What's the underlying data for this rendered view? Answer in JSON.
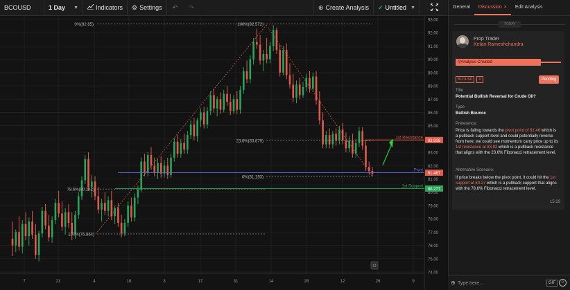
{
  "toolbar": {
    "symbol": "BCOUSD",
    "timeframe": "1 Day",
    "indicators_label": "Indicators",
    "settings_label": "Settings",
    "create_analysis_label": "Create Analysis",
    "untitled_label": "Untitled"
  },
  "chart_data": {
    "type": "candlestick",
    "symbol": "BCOUSD",
    "ylim": [
      74,
      93
    ],
    "y_ticks": [
      "93.00",
      "92.00",
      "91.00",
      "90.00",
      "89.00",
      "88.00",
      "87.00",
      "86.00",
      "85.00",
      "84.00",
      "83.00",
      "82.00",
      "81.00",
      "80.00",
      "79.00",
      "78.00",
      "77.00",
      "76.00",
      "75.00",
      "74.00"
    ],
    "x_ticks": [
      "7",
      "21",
      "4",
      "18",
      "3",
      "17",
      "31",
      "14",
      "28",
      "12",
      "26",
      "9"
    ],
    "price_labels": [
      {
        "value": 83.928,
        "text": "83.928",
        "color": "#e05a4a"
      },
      {
        "value": 81.467,
        "text": "81.467",
        "color": "#e05a4a"
      },
      {
        "value": 80.277,
        "text": "80.277",
        "color": "#2ca55a"
      }
    ],
    "levels": [
      {
        "name": "1st Resistance",
        "value": 83.928,
        "color": "#e05a4a"
      },
      {
        "name": "Pivot",
        "value": 81.467,
        "color": "#5865d8"
      },
      {
        "name": "1st Support",
        "value": 80.277,
        "color": "#2ca55a"
      }
    ],
    "fib_labels": [
      {
        "text": "0%(92.65)",
        "value": 92.65
      },
      {
        "text": "100%(92.572)",
        "value": 92.572
      },
      {
        "text": "23.6%(83.879)",
        "value": 83.879
      },
      {
        "text": "0%(81.193)",
        "value": 81.193
      },
      {
        "text": "78.6%(80.242)",
        "value": 80.242
      },
      {
        "text": "100%(76.864)",
        "value": 76.864
      }
    ],
    "colors": {
      "up": "#26a65b",
      "down": "#e05a4a",
      "bg": "#131313",
      "grid": "#1f1f1f",
      "arrow": "#2bd13a"
    },
    "candles": [
      [
        76.5,
        77.8,
        75.2,
        76.0
      ],
      [
        76.0,
        77.2,
        75.5,
        77.0
      ],
      [
        77.0,
        78.2,
        75.6,
        75.9
      ],
      [
        75.9,
        77.9,
        75.4,
        77.6
      ],
      [
        77.6,
        78.5,
        76.4,
        76.7
      ],
      [
        76.7,
        78.1,
        76.0,
        77.8
      ],
      [
        77.8,
        78.6,
        76.5,
        76.8
      ],
      [
        76.8,
        77.6,
        75.0,
        75.3
      ],
      [
        75.3,
        77.1,
        74.8,
        76.9
      ],
      [
        76.9,
        78.9,
        76.6,
        78.6
      ],
      [
        78.6,
        79.1,
        77.2,
        77.5
      ],
      [
        77.5,
        78.3,
        76.3,
        76.6
      ],
      [
        76.6,
        78.2,
        76.2,
        77.9
      ],
      [
        77.9,
        79.5,
        77.6,
        79.2
      ],
      [
        79.2,
        80.1,
        78.1,
        78.4
      ],
      [
        78.4,
        79.3,
        77.1,
        77.4
      ],
      [
        77.4,
        78.8,
        76.8,
        78.5
      ],
      [
        78.5,
        79.1,
        77.3,
        77.7
      ],
      [
        77.7,
        78.5,
        76.4,
        76.9
      ],
      [
        76.9,
        78.6,
        76.5,
        78.3
      ],
      [
        78.3,
        80.0,
        78.0,
        79.7
      ],
      [
        79.7,
        81.2,
        79.4,
        80.9
      ],
      [
        80.9,
        82.8,
        80.6,
        82.5
      ],
      [
        82.5,
        83.0,
        80.1,
        80.4
      ],
      [
        80.4,
        81.3,
        79.6,
        80.8
      ],
      [
        80.8,
        81.2,
        79.4,
        79.7
      ],
      [
        79.7,
        80.4,
        78.4,
        78.7
      ],
      [
        78.7,
        79.5,
        77.8,
        79.2
      ],
      [
        79.2,
        80.0,
        78.3,
        78.6
      ],
      [
        78.6,
        79.7,
        78.2,
        79.4
      ],
      [
        79.4,
        80.1,
        77.9,
        78.2
      ],
      [
        78.2,
        79.0,
        77.6,
        78.8
      ],
      [
        78.8,
        79.2,
        77.4,
        77.7
      ],
      [
        77.7,
        78.3,
        76.6,
        76.9
      ],
      [
        76.9,
        78.0,
        76.7,
        77.7
      ],
      [
        77.7,
        79.3,
        77.4,
        79.0
      ],
      [
        79.0,
        79.6,
        77.8,
        78.1
      ],
      [
        78.1,
        79.9,
        77.8,
        79.6
      ],
      [
        79.6,
        80.5,
        79.1,
        80.2
      ],
      [
        80.2,
        82.6,
        80.0,
        82.3
      ],
      [
        82.3,
        82.9,
        81.2,
        81.5
      ],
      [
        81.5,
        83.0,
        81.2,
        82.8
      ],
      [
        82.8,
        83.4,
        81.7,
        82.0
      ],
      [
        82.0,
        82.6,
        81.2,
        81.5
      ],
      [
        81.5,
        82.5,
        81.0,
        82.2
      ],
      [
        82.2,
        82.7,
        81.1,
        81.4
      ],
      [
        81.4,
        82.4,
        81.1,
        82.0
      ],
      [
        82.0,
        82.6,
        81.0,
        81.3
      ],
      [
        81.3,
        82.9,
        81.1,
        82.6
      ],
      [
        82.6,
        84.1,
        82.3,
        83.8
      ],
      [
        83.8,
        84.3,
        82.6,
        82.9
      ],
      [
        82.9,
        84.0,
        82.6,
        83.7
      ],
      [
        83.7,
        84.4,
        82.9,
        83.2
      ],
      [
        83.2,
        84.6,
        82.9,
        84.3
      ],
      [
        84.3,
        85.4,
        84.0,
        85.1
      ],
      [
        85.1,
        85.6,
        83.9,
        84.2
      ],
      [
        84.2,
        85.6,
        83.8,
        85.4
      ],
      [
        85.4,
        86.3,
        84.9,
        86.0
      ],
      [
        86.0,
        86.4,
        84.8,
        85.1
      ],
      [
        85.1,
        86.4,
        84.8,
        86.1
      ],
      [
        86.1,
        87.6,
        85.8,
        87.3
      ],
      [
        87.3,
        87.8,
        86.0,
        86.3
      ],
      [
        86.3,
        87.2,
        85.7,
        87.0
      ],
      [
        87.0,
        87.5,
        85.9,
        86.2
      ],
      [
        86.2,
        87.7,
        86.0,
        87.4
      ],
      [
        87.4,
        88.0,
        86.5,
        86.8
      ],
      [
        86.8,
        87.4,
        85.8,
        86.1
      ],
      [
        86.1,
        87.3,
        85.9,
        87.0
      ],
      [
        87.0,
        87.6,
        85.9,
        86.2
      ],
      [
        86.2,
        88.0,
        85.9,
        87.7
      ],
      [
        87.7,
        89.4,
        87.4,
        89.1
      ],
      [
        89.1,
        89.9,
        88.2,
        88.5
      ],
      [
        88.5,
        90.3,
        88.2,
        90.0
      ],
      [
        90.0,
        91.6,
        89.6,
        91.3
      ],
      [
        91.3,
        92.3,
        90.8,
        91.1
      ],
      [
        91.1,
        91.8,
        89.6,
        89.9
      ],
      [
        89.9,
        90.7,
        89.1,
        90.4
      ],
      [
        90.4,
        91.6,
        89.7,
        90.0
      ],
      [
        90.0,
        91.3,
        89.7,
        91.0
      ],
      [
        91.0,
        92.57,
        90.6,
        92.2
      ],
      [
        92.2,
        92.4,
        90.4,
        90.7
      ],
      [
        90.7,
        91.1,
        88.7,
        89.0
      ],
      [
        89.0,
        91.0,
        88.8,
        90.7
      ],
      [
        90.7,
        91.2,
        88.5,
        88.8
      ],
      [
        88.8,
        89.7,
        87.8,
        88.1
      ],
      [
        88.1,
        88.9,
        86.8,
        87.1
      ],
      [
        87.1,
        88.4,
        86.7,
        88.1
      ],
      [
        88.1,
        88.6,
        87.0,
        87.3
      ],
      [
        87.3,
        88.3,
        87.1,
        87.9
      ],
      [
        87.9,
        88.9,
        87.6,
        88.6
      ],
      [
        88.6,
        89.1,
        87.5,
        87.8
      ],
      [
        87.8,
        89.0,
        87.6,
        88.7
      ],
      [
        88.7,
        89.1,
        86.6,
        86.9
      ],
      [
        86.9,
        87.6,
        85.1,
        85.4
      ],
      [
        85.4,
        86.0,
        83.3,
        83.6
      ],
      [
        83.6,
        84.6,
        83.3,
        84.3
      ],
      [
        84.3,
        84.8,
        83.3,
        83.6
      ],
      [
        83.6,
        84.6,
        83.3,
        84.4
      ],
      [
        84.4,
        84.8,
        83.5,
        83.9
      ],
      [
        83.9,
        85.0,
        83.6,
        84.7
      ],
      [
        84.7,
        85.2,
        83.6,
        83.9
      ],
      [
        83.9,
        84.5,
        83.0,
        83.3
      ],
      [
        83.3,
        84.2,
        83.0,
        83.9
      ],
      [
        83.9,
        84.4,
        82.6,
        82.9
      ],
      [
        82.9,
        84.0,
        82.6,
        83.7
      ],
      [
        83.7,
        84.9,
        83.4,
        84.6
      ],
      [
        84.6,
        84.9,
        83.2,
        83.5
      ],
      [
        83.5,
        83.9,
        81.6,
        81.9
      ],
      [
        81.9,
        82.3,
        81.3,
        81.6
      ],
      [
        81.6,
        81.9,
        81.193,
        81.4
      ]
    ]
  },
  "panel": {
    "tabs": [
      {
        "label": "General"
      },
      {
        "label": "Discussion",
        "close": "×"
      },
      {
        "label": "Edit Analysis"
      }
    ],
    "today_label": "TODAY",
    "post": {
      "role": "Prop Trader",
      "author": "Ketan Rameshchandra",
      "event": "Analysis Created",
      "tickers": [
        "BCOUSD",
        "D"
      ],
      "status": "Pending",
      "title_label": "Title",
      "title": "Potential Bullish Reversal for Crude Oil?",
      "type_label": "Type",
      "type": "Bullish Bounce",
      "preference_label": "Preference:",
      "preference": [
        {
          "t": "Price is falling towards the ",
          "h": false
        },
        {
          "t": "pivot point of 81.46",
          "h": true
        },
        {
          "t": " which is a pullback support level and could potentially reverse from here; we could see momentum carry price up to its ",
          "h": false
        },
        {
          "t": "1st resistance at 83.92",
          "h": true
        },
        {
          "t": " which is a pullback resistance that aligns with the 23.6% Fibonacci retracement level.",
          "h": false
        }
      ],
      "alt_label": "Alternative Scenario:",
      "alternative": [
        {
          "t": "If price breaks below the pivot point, it could hit the ",
          "h": false
        },
        {
          "t": "1st support at 80.27",
          "h": true
        },
        {
          "t": " which is a pullback support that aligns with the 78.6% Fibonacci retracement level.",
          "h": false
        }
      ],
      "time": "15:29"
    },
    "chat": {
      "placeholder": "Type here...",
      "gif_label": "GIF"
    }
  }
}
